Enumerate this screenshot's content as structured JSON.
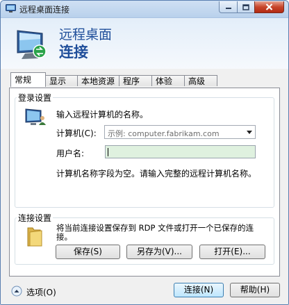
{
  "window": {
    "title": "远程桌面连接"
  },
  "header": {
    "line1": "远程桌面",
    "line2": "连接"
  },
  "tabs": [
    {
      "label": "常规"
    },
    {
      "label": "显示"
    },
    {
      "label": "本地资源"
    },
    {
      "label": "程序"
    },
    {
      "label": "体验"
    },
    {
      "label": "高级"
    }
  ],
  "login": {
    "group_label": "登录设置",
    "instruction": "输入远程计算机的名称。",
    "computer_label": "计算机(C):",
    "computer_placeholder": "示例: computer.fabrikam.com",
    "username_label": "用户名:",
    "username_value": "",
    "warning": "计算机名称字段为空。请输入完整的远程计算机名称。"
  },
  "connection": {
    "group_label": "连接设置",
    "description": "将当前连接设置保存到 RDP 文件或打开一个已保存的连接。",
    "save_label": "保存(S)",
    "save_as_label": "另存为(V)...",
    "open_label": "打开(E)..."
  },
  "footer": {
    "options_label": "选项(O)",
    "connect_label": "连接(N)",
    "help_label": "帮助(H)"
  }
}
